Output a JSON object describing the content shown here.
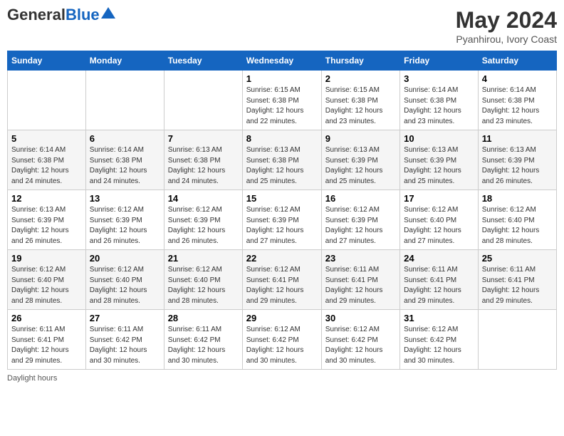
{
  "header": {
    "logo_general": "General",
    "logo_blue": "Blue",
    "month_year": "May 2024",
    "location": "Pyanhirou, Ivory Coast"
  },
  "weekdays": [
    "Sunday",
    "Monday",
    "Tuesday",
    "Wednesday",
    "Thursday",
    "Friday",
    "Saturday"
  ],
  "weeks": [
    [
      {
        "day": "",
        "info": ""
      },
      {
        "day": "",
        "info": ""
      },
      {
        "day": "",
        "info": ""
      },
      {
        "day": "1",
        "info": "Sunrise: 6:15 AM\nSunset: 6:38 PM\nDaylight: 12 hours\nand 22 minutes."
      },
      {
        "day": "2",
        "info": "Sunrise: 6:15 AM\nSunset: 6:38 PM\nDaylight: 12 hours\nand 23 minutes."
      },
      {
        "day": "3",
        "info": "Sunrise: 6:14 AM\nSunset: 6:38 PM\nDaylight: 12 hours\nand 23 minutes."
      },
      {
        "day": "4",
        "info": "Sunrise: 6:14 AM\nSunset: 6:38 PM\nDaylight: 12 hours\nand 23 minutes."
      }
    ],
    [
      {
        "day": "5",
        "info": "Sunrise: 6:14 AM\nSunset: 6:38 PM\nDaylight: 12 hours\nand 24 minutes."
      },
      {
        "day": "6",
        "info": "Sunrise: 6:14 AM\nSunset: 6:38 PM\nDaylight: 12 hours\nand 24 minutes."
      },
      {
        "day": "7",
        "info": "Sunrise: 6:13 AM\nSunset: 6:38 PM\nDaylight: 12 hours\nand 24 minutes."
      },
      {
        "day": "8",
        "info": "Sunrise: 6:13 AM\nSunset: 6:38 PM\nDaylight: 12 hours\nand 25 minutes."
      },
      {
        "day": "9",
        "info": "Sunrise: 6:13 AM\nSunset: 6:39 PM\nDaylight: 12 hours\nand 25 minutes."
      },
      {
        "day": "10",
        "info": "Sunrise: 6:13 AM\nSunset: 6:39 PM\nDaylight: 12 hours\nand 25 minutes."
      },
      {
        "day": "11",
        "info": "Sunrise: 6:13 AM\nSunset: 6:39 PM\nDaylight: 12 hours\nand 26 minutes."
      }
    ],
    [
      {
        "day": "12",
        "info": "Sunrise: 6:13 AM\nSunset: 6:39 PM\nDaylight: 12 hours\nand 26 minutes."
      },
      {
        "day": "13",
        "info": "Sunrise: 6:12 AM\nSunset: 6:39 PM\nDaylight: 12 hours\nand 26 minutes."
      },
      {
        "day": "14",
        "info": "Sunrise: 6:12 AM\nSunset: 6:39 PM\nDaylight: 12 hours\nand 26 minutes."
      },
      {
        "day": "15",
        "info": "Sunrise: 6:12 AM\nSunset: 6:39 PM\nDaylight: 12 hours\nand 27 minutes."
      },
      {
        "day": "16",
        "info": "Sunrise: 6:12 AM\nSunset: 6:39 PM\nDaylight: 12 hours\nand 27 minutes."
      },
      {
        "day": "17",
        "info": "Sunrise: 6:12 AM\nSunset: 6:40 PM\nDaylight: 12 hours\nand 27 minutes."
      },
      {
        "day": "18",
        "info": "Sunrise: 6:12 AM\nSunset: 6:40 PM\nDaylight: 12 hours\nand 28 minutes."
      }
    ],
    [
      {
        "day": "19",
        "info": "Sunrise: 6:12 AM\nSunset: 6:40 PM\nDaylight: 12 hours\nand 28 minutes."
      },
      {
        "day": "20",
        "info": "Sunrise: 6:12 AM\nSunset: 6:40 PM\nDaylight: 12 hours\nand 28 minutes."
      },
      {
        "day": "21",
        "info": "Sunrise: 6:12 AM\nSunset: 6:40 PM\nDaylight: 12 hours\nand 28 minutes."
      },
      {
        "day": "22",
        "info": "Sunrise: 6:12 AM\nSunset: 6:41 PM\nDaylight: 12 hours\nand 29 minutes."
      },
      {
        "day": "23",
        "info": "Sunrise: 6:11 AM\nSunset: 6:41 PM\nDaylight: 12 hours\nand 29 minutes."
      },
      {
        "day": "24",
        "info": "Sunrise: 6:11 AM\nSunset: 6:41 PM\nDaylight: 12 hours\nand 29 minutes."
      },
      {
        "day": "25",
        "info": "Sunrise: 6:11 AM\nSunset: 6:41 PM\nDaylight: 12 hours\nand 29 minutes."
      }
    ],
    [
      {
        "day": "26",
        "info": "Sunrise: 6:11 AM\nSunset: 6:41 PM\nDaylight: 12 hours\nand 29 minutes."
      },
      {
        "day": "27",
        "info": "Sunrise: 6:11 AM\nSunset: 6:42 PM\nDaylight: 12 hours\nand 30 minutes."
      },
      {
        "day": "28",
        "info": "Sunrise: 6:11 AM\nSunset: 6:42 PM\nDaylight: 12 hours\nand 30 minutes."
      },
      {
        "day": "29",
        "info": "Sunrise: 6:12 AM\nSunset: 6:42 PM\nDaylight: 12 hours\nand 30 minutes."
      },
      {
        "day": "30",
        "info": "Sunrise: 6:12 AM\nSunset: 6:42 PM\nDaylight: 12 hours\nand 30 minutes."
      },
      {
        "day": "31",
        "info": "Sunrise: 6:12 AM\nSunset: 6:42 PM\nDaylight: 12 hours\nand 30 minutes."
      },
      {
        "day": "",
        "info": ""
      }
    ]
  ],
  "footer": {
    "daylight_label": "Daylight hours"
  }
}
